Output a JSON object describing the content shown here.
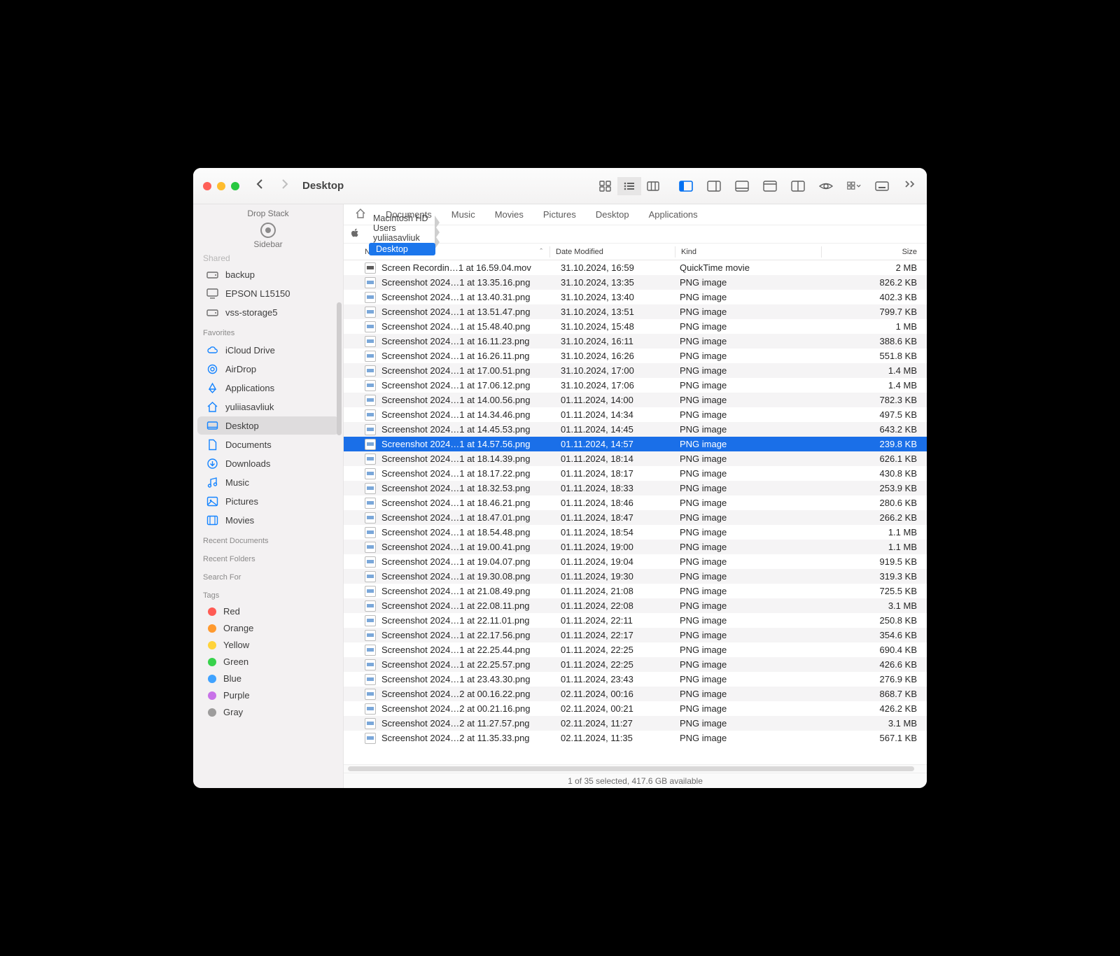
{
  "window_title": "Desktop",
  "drop_stack_label": "Drop Stack",
  "sidebar_label": "Sidebar",
  "shared_cut": "Shared",
  "favbar": [
    "Documents",
    "Music",
    "Movies",
    "Pictures",
    "Desktop",
    "Applications"
  ],
  "path": [
    "Macintosh HD",
    "Users",
    "yuliiasavliuk",
    "Desktop"
  ],
  "columns": {
    "name": "Name",
    "date": "Date Modified",
    "kind": "Kind",
    "size": "Size"
  },
  "sidebar_top": [
    {
      "label": "backup",
      "icon": "drive"
    },
    {
      "label": "EPSON L15150",
      "icon": "display"
    },
    {
      "label": "vss-storage5",
      "icon": "drive"
    }
  ],
  "favorites_title": "Favorites",
  "favorites": [
    {
      "label": "iCloud Drive",
      "icon": "cloud"
    },
    {
      "label": "AirDrop",
      "icon": "airdrop"
    },
    {
      "label": "Applications",
      "icon": "app"
    },
    {
      "label": "yuliiasavliuk",
      "icon": "home"
    },
    {
      "label": "Desktop",
      "icon": "desktop",
      "selected": true
    },
    {
      "label": "Documents",
      "icon": "doc"
    },
    {
      "label": "Downloads",
      "icon": "down"
    },
    {
      "label": "Music",
      "icon": "music"
    },
    {
      "label": "Pictures",
      "icon": "pic"
    },
    {
      "label": "Movies",
      "icon": "movie"
    }
  ],
  "recent_docs": "Recent Documents",
  "recent_folders": "Recent Folders",
  "search_for": "Search For",
  "tags_title": "Tags",
  "tags": [
    {
      "label": "Red",
      "color": "#ff5b54"
    },
    {
      "label": "Orange",
      "color": "#ff9a2f"
    },
    {
      "label": "Yellow",
      "color": "#ffd33a"
    },
    {
      "label": "Green",
      "color": "#38d24c"
    },
    {
      "label": "Blue",
      "color": "#3fa2ff"
    },
    {
      "label": "Purple",
      "color": "#c872e8"
    },
    {
      "label": "Gray",
      "color": "#9d9c9c"
    }
  ],
  "files": [
    {
      "name": "Screen Recordin…1 at 16.59.04.mov",
      "date": "31.10.2024, 16:59",
      "kind": "QuickTime movie",
      "size": "2 MB",
      "mov": true
    },
    {
      "name": "Screenshot 2024…1 at 13.35.16.png",
      "date": "31.10.2024, 13:35",
      "kind": "PNG image",
      "size": "826.2 KB"
    },
    {
      "name": "Screenshot 2024…1 at 13.40.31.png",
      "date": "31.10.2024, 13:40",
      "kind": "PNG image",
      "size": "402.3 KB"
    },
    {
      "name": "Screenshot 2024…1 at 13.51.47.png",
      "date": "31.10.2024, 13:51",
      "kind": "PNG image",
      "size": "799.7 KB"
    },
    {
      "name": "Screenshot 2024…1 at 15.48.40.png",
      "date": "31.10.2024, 15:48",
      "kind": "PNG image",
      "size": "1 MB"
    },
    {
      "name": "Screenshot 2024…1 at 16.11.23.png",
      "date": "31.10.2024, 16:11",
      "kind": "PNG image",
      "size": "388.6 KB"
    },
    {
      "name": "Screenshot 2024…1 at 16.26.11.png",
      "date": "31.10.2024, 16:26",
      "kind": "PNG image",
      "size": "551.8 KB"
    },
    {
      "name": "Screenshot 2024…1 at 17.00.51.png",
      "date": "31.10.2024, 17:00",
      "kind": "PNG image",
      "size": "1.4 MB"
    },
    {
      "name": "Screenshot 2024…1 at 17.06.12.png",
      "date": "31.10.2024, 17:06",
      "kind": "PNG image",
      "size": "1.4 MB"
    },
    {
      "name": "Screenshot 2024…1 at 14.00.56.png",
      "date": "01.11.2024, 14:00",
      "kind": "PNG image",
      "size": "782.3 KB"
    },
    {
      "name": "Screenshot 2024…1 at 14.34.46.png",
      "date": "01.11.2024, 14:34",
      "kind": "PNG image",
      "size": "497.5 KB"
    },
    {
      "name": "Screenshot 2024…1 at 14.45.53.png",
      "date": "01.11.2024, 14:45",
      "kind": "PNG image",
      "size": "643.2 KB"
    },
    {
      "name": "Screenshot 2024…1 at 14.57.56.png",
      "date": "01.11.2024, 14:57",
      "kind": "PNG image",
      "size": "239.8 KB",
      "selected": true
    },
    {
      "name": "Screenshot 2024…1 at 18.14.39.png",
      "date": "01.11.2024, 18:14",
      "kind": "PNG image",
      "size": "626.1 KB"
    },
    {
      "name": "Screenshot 2024…1 at 18.17.22.png",
      "date": "01.11.2024, 18:17",
      "kind": "PNG image",
      "size": "430.8 KB"
    },
    {
      "name": "Screenshot 2024…1 at 18.32.53.png",
      "date": "01.11.2024, 18:33",
      "kind": "PNG image",
      "size": "253.9 KB"
    },
    {
      "name": "Screenshot 2024…1 at 18.46.21.png",
      "date": "01.11.2024, 18:46",
      "kind": "PNG image",
      "size": "280.6 KB"
    },
    {
      "name": "Screenshot 2024…1 at 18.47.01.png",
      "date": "01.11.2024, 18:47",
      "kind": "PNG image",
      "size": "266.2 KB"
    },
    {
      "name": "Screenshot 2024…1 at 18.54.48.png",
      "date": "01.11.2024, 18:54",
      "kind": "PNG image",
      "size": "1.1 MB"
    },
    {
      "name": "Screenshot 2024…1 at 19.00.41.png",
      "date": "01.11.2024, 19:00",
      "kind": "PNG image",
      "size": "1.1 MB"
    },
    {
      "name": "Screenshot 2024…1 at 19.04.07.png",
      "date": "01.11.2024, 19:04",
      "kind": "PNG image",
      "size": "919.5 KB"
    },
    {
      "name": "Screenshot 2024…1 at 19.30.08.png",
      "date": "01.11.2024, 19:30",
      "kind": "PNG image",
      "size": "319.3 KB"
    },
    {
      "name": "Screenshot 2024…1 at 21.08.49.png",
      "date": "01.11.2024, 21:08",
      "kind": "PNG image",
      "size": "725.5 KB"
    },
    {
      "name": "Screenshot 2024…1 at 22.08.11.png",
      "date": "01.11.2024, 22:08",
      "kind": "PNG image",
      "size": "3.1 MB"
    },
    {
      "name": "Screenshot 2024…1 at 22.11.01.png",
      "date": "01.11.2024, 22:11",
      "kind": "PNG image",
      "size": "250.8 KB"
    },
    {
      "name": "Screenshot 2024…1 at 22.17.56.png",
      "date": "01.11.2024, 22:17",
      "kind": "PNG image",
      "size": "354.6 KB"
    },
    {
      "name": "Screenshot 2024…1 at 22.25.44.png",
      "date": "01.11.2024, 22:25",
      "kind": "PNG image",
      "size": "690.4 KB"
    },
    {
      "name": "Screenshot 2024…1 at 22.25.57.png",
      "date": "01.11.2024, 22:25",
      "kind": "PNG image",
      "size": "426.6 KB"
    },
    {
      "name": "Screenshot 2024…1 at 23.43.30.png",
      "date": "01.11.2024, 23:43",
      "kind": "PNG image",
      "size": "276.9 KB"
    },
    {
      "name": "Screenshot 2024…2 at 00.16.22.png",
      "date": "02.11.2024, 00:16",
      "kind": "PNG image",
      "size": "868.7 KB"
    },
    {
      "name": "Screenshot 2024…2 at 00.21.16.png",
      "date": "02.11.2024, 00:21",
      "kind": "PNG image",
      "size": "426.2 KB"
    },
    {
      "name": "Screenshot 2024…2 at 11.27.57.png",
      "date": "02.11.2024, 11:27",
      "kind": "PNG image",
      "size": "3.1 MB"
    },
    {
      "name": "Screenshot 2024…2 at 11.35.33.png",
      "date": "02.11.2024, 11:35",
      "kind": "PNG image",
      "size": "567.1 KB"
    }
  ],
  "status": "1 of 35 selected, 417.6 GB available"
}
